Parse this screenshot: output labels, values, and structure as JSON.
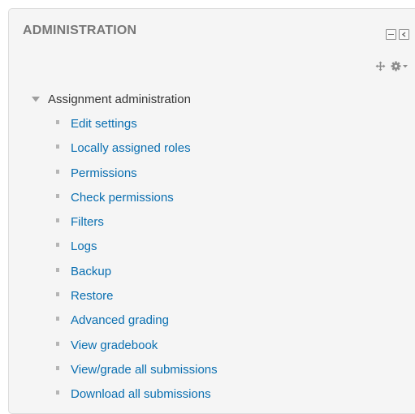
{
  "block": {
    "title": "ADMINISTRATION",
    "controls": {
      "hide": "hide-block-icon",
      "dock": "dock-block-icon",
      "move": "move-icon",
      "actions": "gear-icon"
    }
  },
  "tree": {
    "root_label": "Assignment administration",
    "items": [
      {
        "label": "Edit settings"
      },
      {
        "label": "Locally assigned roles"
      },
      {
        "label": "Permissions"
      },
      {
        "label": "Check permissions"
      },
      {
        "label": "Filters"
      },
      {
        "label": "Logs"
      },
      {
        "label": "Backup"
      },
      {
        "label": "Restore"
      },
      {
        "label": "Advanced grading"
      },
      {
        "label": "View gradebook"
      },
      {
        "label": "View/grade all submissions"
      },
      {
        "label": "Download all submissions"
      }
    ]
  },
  "colors": {
    "block_bg": "#f5f5f5",
    "title": "#777777",
    "link": "#0a6fb1",
    "text": "#333333"
  }
}
